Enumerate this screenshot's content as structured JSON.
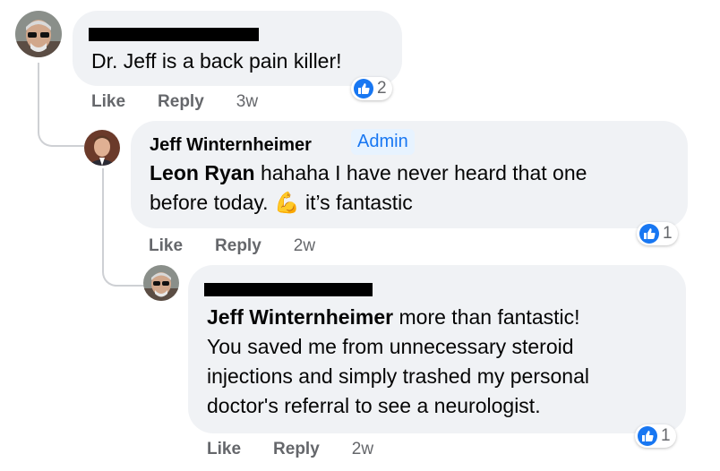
{
  "comments": [
    {
      "text": "Dr. Jeff is a back pain killer!",
      "actions": {
        "like": "Like",
        "reply": "Reply",
        "time": "3w"
      },
      "reaction_count": "2"
    },
    {
      "author": "Jeff Winternheimer",
      "badge": "Admin",
      "mention": "Leon Ryan",
      "text_line1": " hahaha I have never heard that one",
      "text_line2": "before today. ",
      "emoji": "💪",
      "text_line2_end": " it’s fantastic",
      "actions": {
        "like": "Like",
        "reply": "Reply",
        "time": "2w"
      },
      "reaction_count": "1"
    },
    {
      "mention": "Jeff Winternheimer",
      "text_line1": " more than fantastic!",
      "text_line2": "You saved me from unnecessary steroid",
      "text_line3": "injections and simply trashed my personal",
      "text_line4": "doctor's referral to see a neurologist.",
      "actions": {
        "like": "Like",
        "reply": "Reply",
        "time": "2w"
      },
      "reaction_count": "1"
    }
  ],
  "icons": {
    "reaction": "like-thumb-icon",
    "avatar": "user-avatar"
  },
  "colors": {
    "bubble": "#f0f2f5",
    "accent": "#1877f2",
    "meta": "#65676b"
  }
}
